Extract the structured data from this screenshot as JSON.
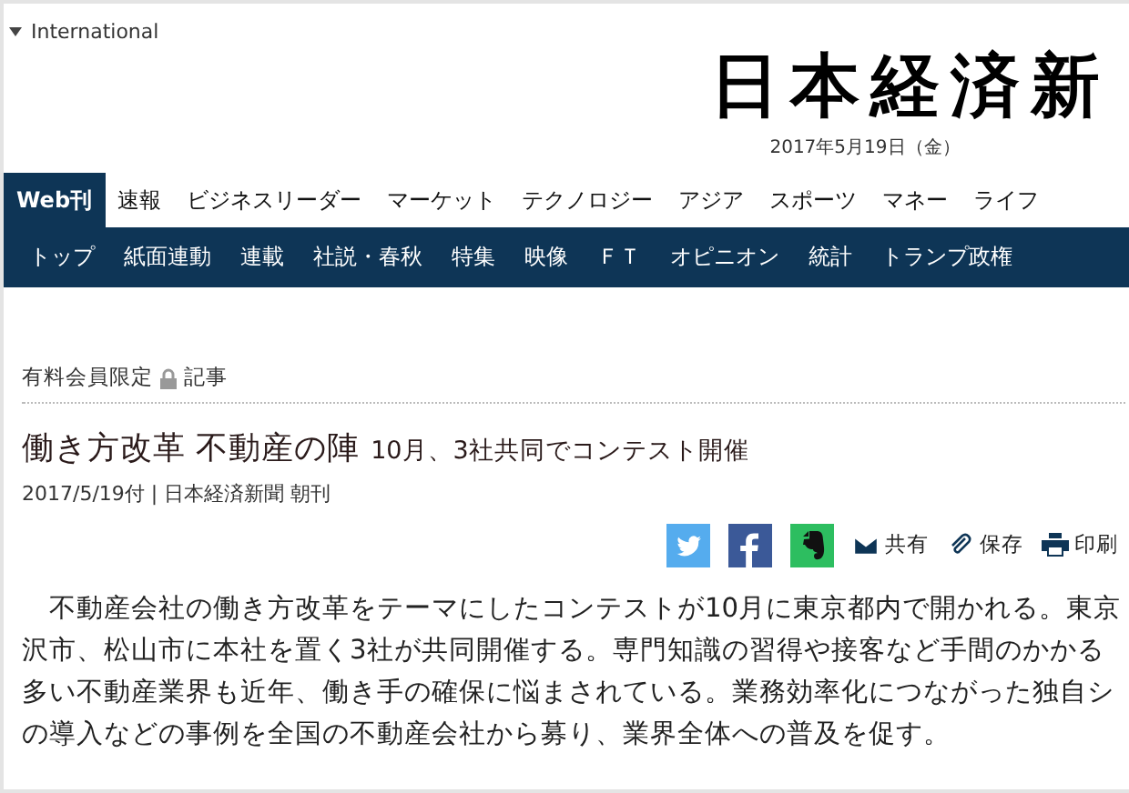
{
  "edition_menu": {
    "label": "International"
  },
  "masthead": {
    "logo": "日本経済新",
    "date": "2017年5月19日（金）"
  },
  "main_nav": [
    {
      "label": "Web刊",
      "selected": true
    },
    {
      "label": "速報",
      "selected": false
    },
    {
      "label": "ビジネスリーダー",
      "selected": false
    },
    {
      "label": "マーケット",
      "selected": false
    },
    {
      "label": "テクノロジー",
      "selected": false
    },
    {
      "label": "アジア",
      "selected": false
    },
    {
      "label": "スポーツ",
      "selected": false
    },
    {
      "label": "マネー",
      "selected": false
    },
    {
      "label": "ライフ",
      "selected": false
    }
  ],
  "sub_nav": [
    "トップ",
    "紙面連動",
    "連載",
    "社説・春秋",
    "特集",
    "映像",
    "ＦＴ",
    "オピニオン",
    "統計",
    "トランプ政権"
  ],
  "article": {
    "access_prefix": "有料会員限定",
    "access_suffix": "記事",
    "headline": "働き方改革 不動産の陣",
    "subheadline": "10月、3社共同でコンテスト開催",
    "byline": "2017/5/19付 | 日本経済新聞  朝刊",
    "share": [
      {
        "kind": "twitter"
      },
      {
        "kind": "facebook"
      },
      {
        "kind": "evernote"
      },
      {
        "kind": "mail",
        "label": "共有"
      },
      {
        "kind": "clip",
        "label": "保存"
      },
      {
        "kind": "print",
        "label": "印刷"
      }
    ],
    "body_lines": [
      "　不動産会社の働き方改革をテーマにしたコンテストが10月に東京都内で開かれる。東京",
      "沢市、松山市に本社を置く3社が共同開催する。専門知識の習得や接客など手間のかかる",
      "多い不動産業界も近年、働き手の確保に悩まされている。業務効率化につながった独自シ",
      "の導入などの事例を全国の不動産会社から募り、業界全体への普及を促す。"
    ]
  }
}
